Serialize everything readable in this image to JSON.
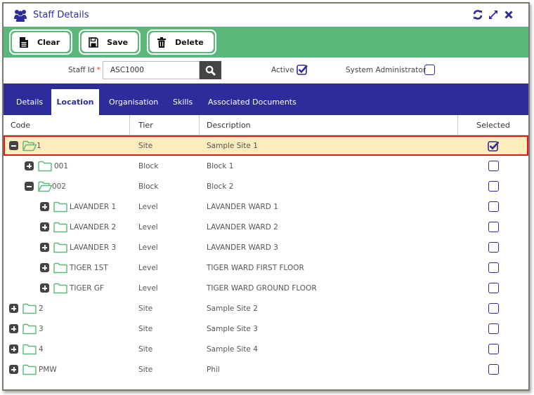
{
  "window": {
    "title": "Staff Details",
    "icons": [
      "users-icon",
      "refresh-icon",
      "expand-icon",
      "close-icon"
    ]
  },
  "toolbar": {
    "clear_label": "Clear",
    "save_label": "Save",
    "delete_label": "Delete"
  },
  "form": {
    "staff_id_label": "Staff Id",
    "required_mark": "*",
    "staff_id_value": "ASC1000",
    "active_label": "Active",
    "active_checked": true,
    "sysadmin_label": "System Administrator",
    "sysadmin_checked": false
  },
  "tabs": [
    {
      "label": "Details",
      "active": false
    },
    {
      "label": "Location",
      "active": true
    },
    {
      "label": "Organisation",
      "active": false
    },
    {
      "label": "Skills",
      "active": false
    },
    {
      "label": "Associated Documents",
      "active": false
    }
  ],
  "grid": {
    "columns": [
      "Code",
      "Tier",
      "Description",
      "Selected"
    ],
    "rows": [
      {
        "code": "1",
        "tier": "Site",
        "description": "Sample Site 1",
        "level": 0,
        "expanded": true,
        "selected": true,
        "highlighted": true
      },
      {
        "code": "001",
        "tier": "Block",
        "description": "Block 1",
        "level": 1,
        "expanded": false,
        "selected": false
      },
      {
        "code": "002",
        "tier": "Block",
        "description": "Block 2",
        "level": 1,
        "expanded": true,
        "selected": false
      },
      {
        "code": "LAVANDER 1",
        "tier": "Level",
        "description": "LAVANDER WARD 1",
        "level": 2,
        "expanded": false,
        "selected": false
      },
      {
        "code": "LAVANDER 2",
        "tier": "Level",
        "description": "LAVANDER WARD 2",
        "level": 2,
        "expanded": false,
        "selected": false
      },
      {
        "code": "LAVANDER 3",
        "tier": "Level",
        "description": "LAVANDER WARD 3",
        "level": 2,
        "expanded": false,
        "selected": false
      },
      {
        "code": "TIGER 1ST",
        "tier": "Level",
        "description": "TIGER WARD FIRST FLOOR",
        "level": 2,
        "expanded": false,
        "selected": false
      },
      {
        "code": "TIGER GF",
        "tier": "Level",
        "description": "TIGER WARD GROUND FLOOR",
        "level": 2,
        "expanded": false,
        "selected": false
      },
      {
        "code": "2",
        "tier": "Site",
        "description": "Sample Site 2",
        "level": 0,
        "expanded": false,
        "selected": false
      },
      {
        "code": "3",
        "tier": "Site",
        "description": "Sample Site 3",
        "level": 0,
        "expanded": false,
        "selected": false
      },
      {
        "code": "4",
        "tier": "Site",
        "description": "Sample Site 4",
        "level": 0,
        "expanded": false,
        "selected": false
      },
      {
        "code": "PMW",
        "tier": "Site",
        "description": "Phil",
        "level": 0,
        "expanded": false,
        "selected": false
      }
    ]
  },
  "colors": {
    "brand": "#2e2b9a",
    "toolbar": "#5bb87a",
    "folder": "#5bb87a",
    "highlight_row": "#fdecbc",
    "highlight_border": "#e8141c"
  }
}
